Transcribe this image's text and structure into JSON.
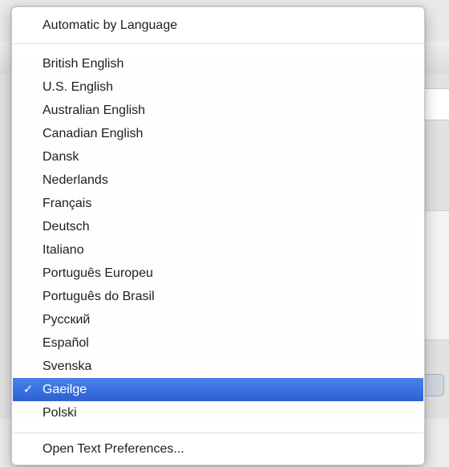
{
  "menu": {
    "header_item": "Automatic by Language",
    "languages": [
      "British English",
      "U.S. English",
      "Australian English",
      "Canadian English",
      "Dansk",
      "Nederlands",
      "Français",
      "Deutsch",
      "Italiano",
      "Português Europeu",
      "Português do Brasil",
      "Русский",
      "Español",
      "Svenska",
      "Gaeilge",
      "Polski"
    ],
    "selected_language": "Gaeilge",
    "checkmark": "✓",
    "footer_item": "Open Text Preferences..."
  },
  "colors": {
    "selection": "#2d60d4"
  },
  "icons": {
    "checkmark": "checkmark-icon"
  }
}
